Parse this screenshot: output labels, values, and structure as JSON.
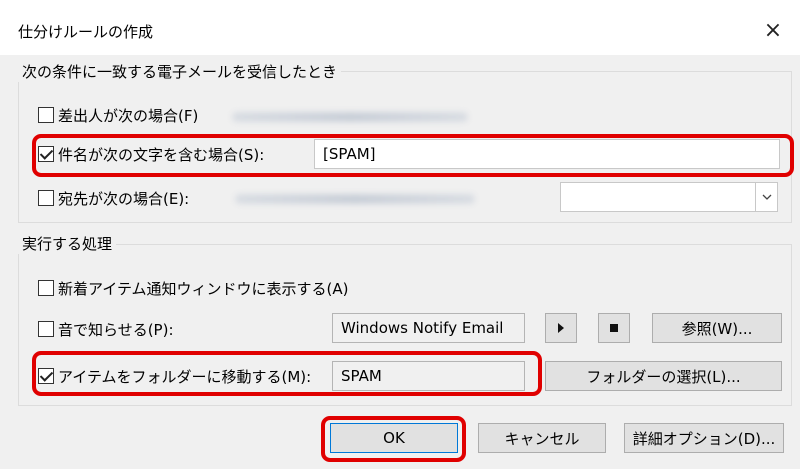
{
  "window": {
    "title": "仕分けルールの作成",
    "close_glyph": "×"
  },
  "conditions": {
    "group_label": "次の条件に一致する電子メールを受信したとき",
    "from": {
      "label": "差出人が次の場合(F)",
      "checked": false
    },
    "subject": {
      "label": "件名が次の文字を含む場合(S):",
      "checked": true,
      "value": "[SPAM]"
    },
    "to": {
      "label": "宛先が次の場合(E):",
      "checked": false
    }
  },
  "actions": {
    "group_label": "実行する処理",
    "alert": {
      "label": "新着アイテム通知ウィンドウに表示する(A)",
      "checked": false
    },
    "sound": {
      "label": "音で知らせる(P):",
      "checked": false,
      "value": "Windows Notify Email"
    },
    "browse_label": "参照(W)...",
    "move": {
      "label": "アイテムをフォルダーに移動する(M):",
      "checked": true,
      "value": "SPAM"
    },
    "select_folder_label": "フォルダーの選択(L)..."
  },
  "buttons": {
    "ok": "OK",
    "cancel": "キャンセル",
    "advanced": "詳細オプション(D)..."
  },
  "icons": {
    "play": "play-icon",
    "stop": "stop-icon",
    "dropdown": "chevron-down-icon",
    "close": "close-icon"
  },
  "colors": {
    "highlight": "#e00000",
    "dialog_bg": "#f0f0f0",
    "button_bg": "#e1e1e1",
    "default_button_border": "#0078d7"
  }
}
